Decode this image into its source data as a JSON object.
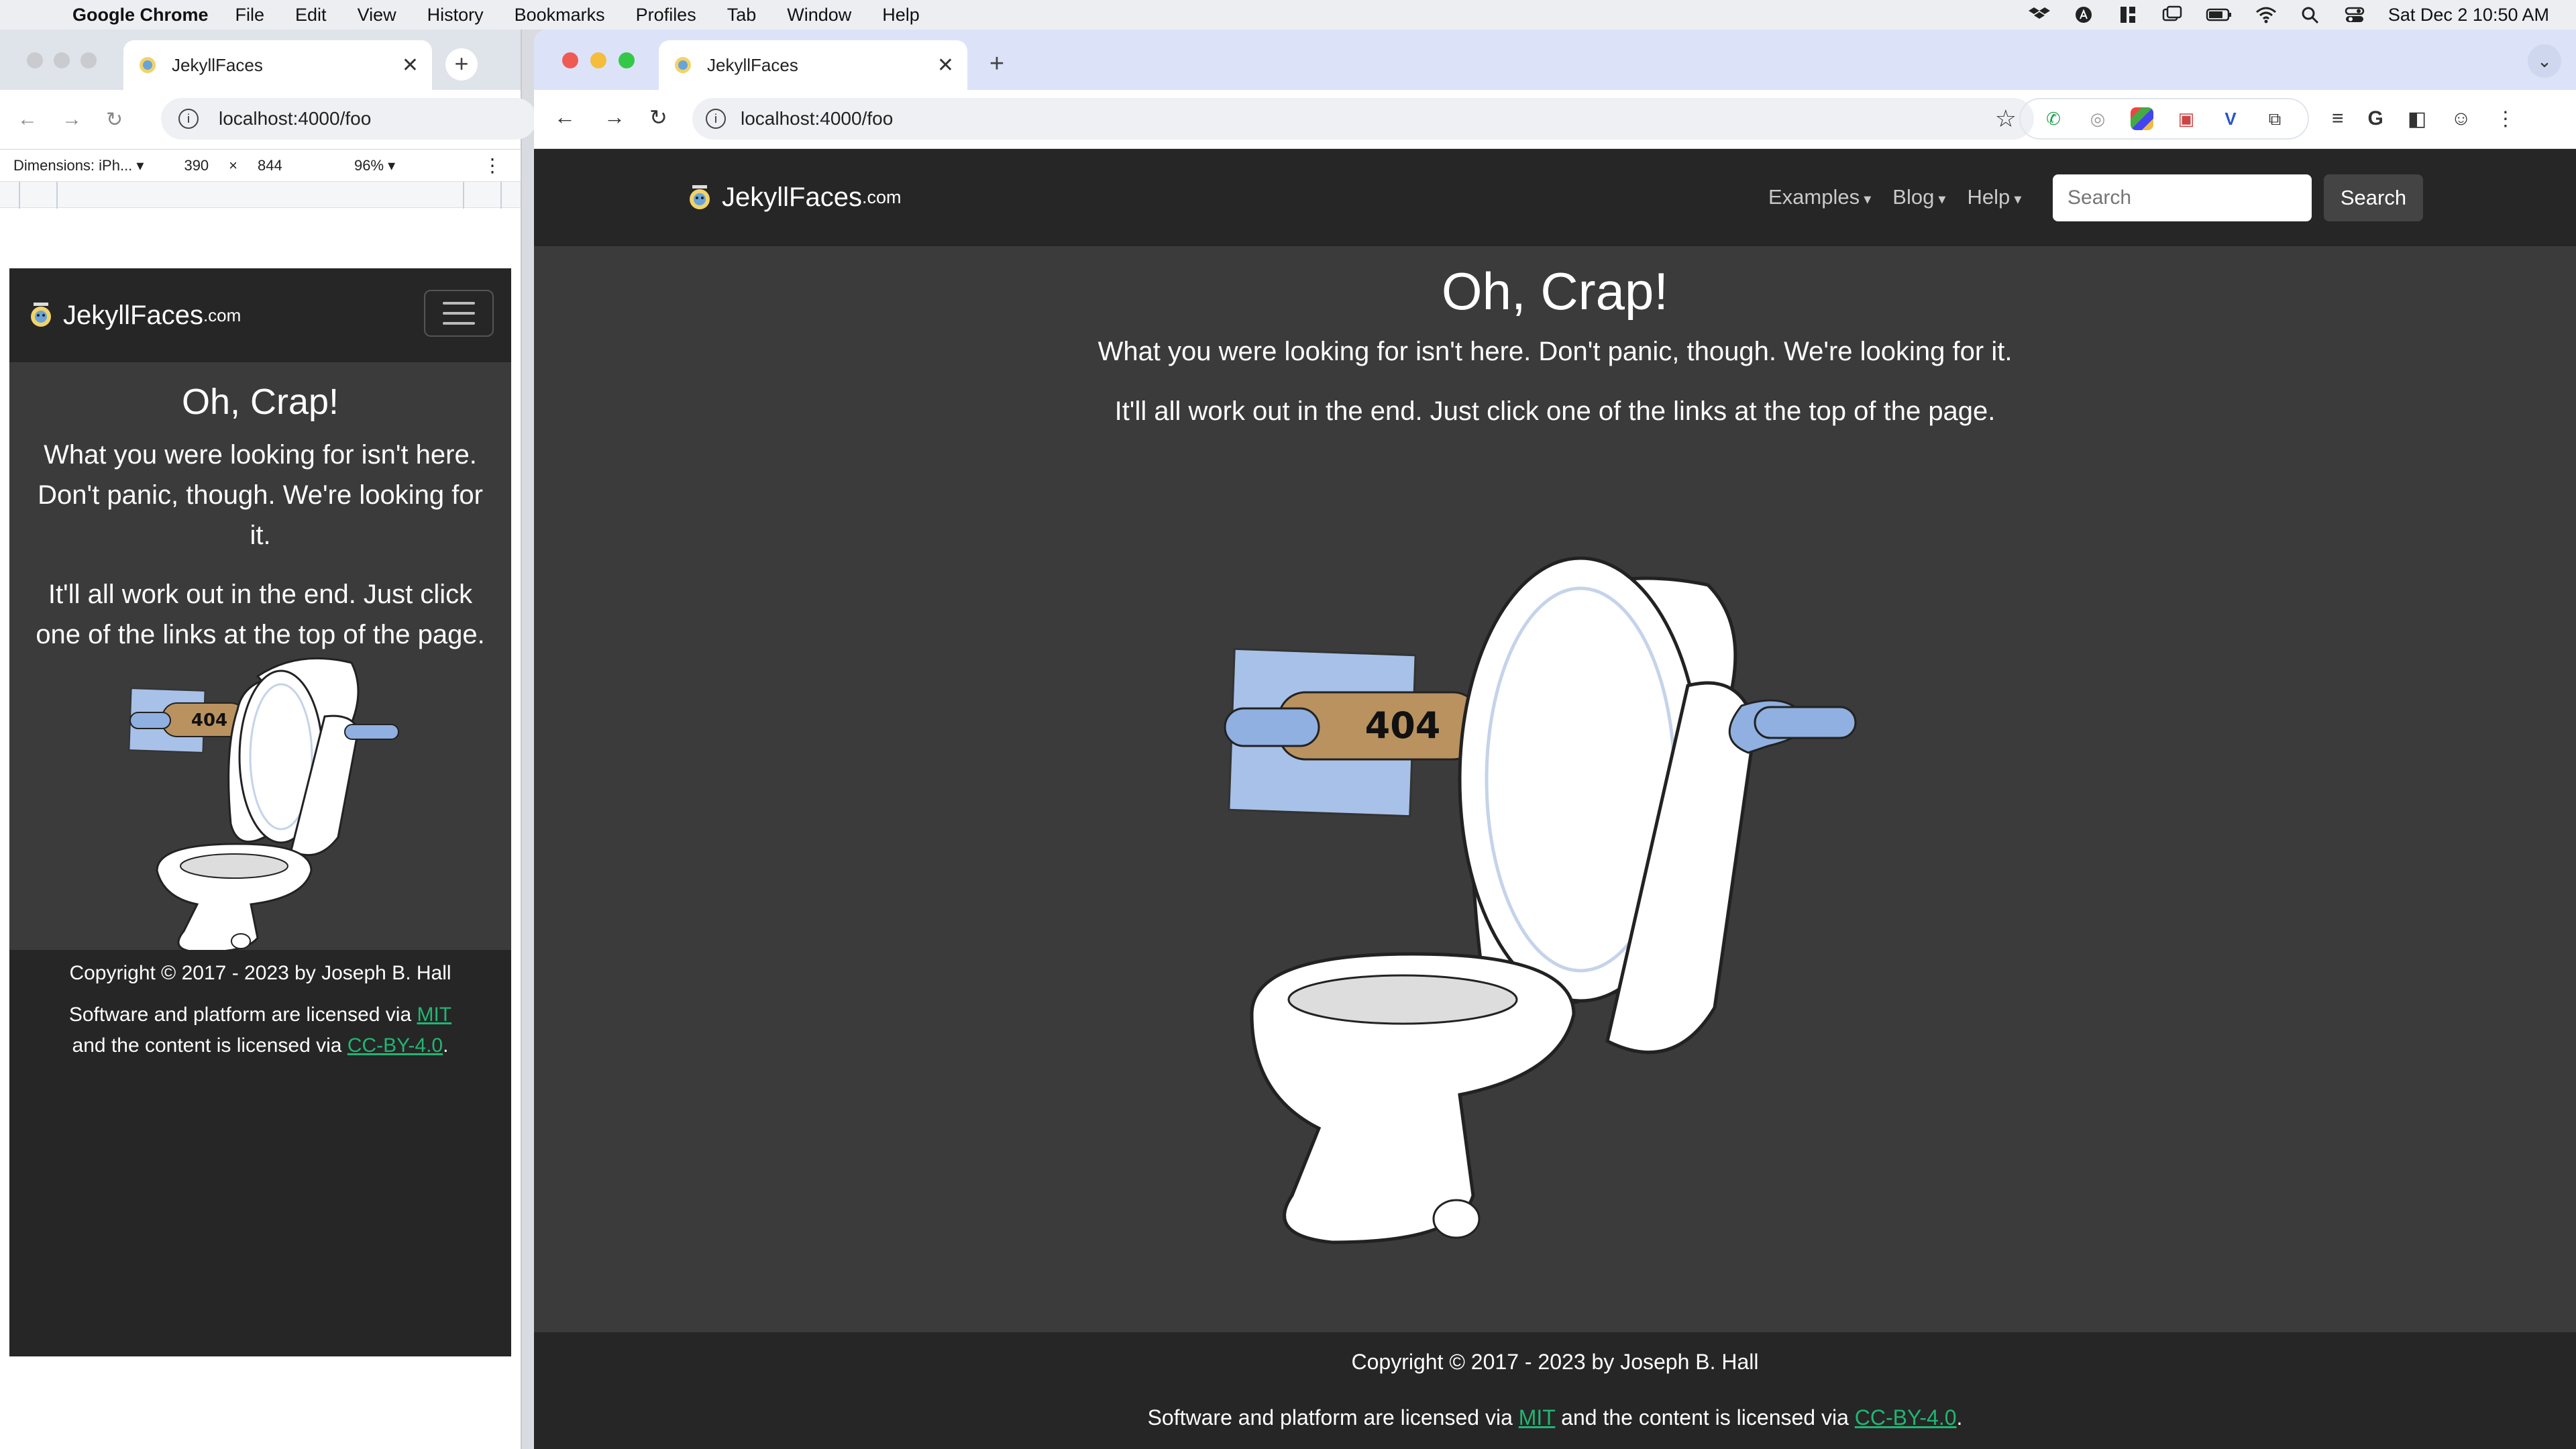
{
  "menubar": {
    "app": "Google Chrome",
    "items": [
      "File",
      "Edit",
      "View",
      "History",
      "Bookmarks",
      "Profiles",
      "Tab",
      "Window",
      "Help"
    ],
    "datetime": "Sat Dec 2  10:50 AM"
  },
  "left_window": {
    "tab_title": "JekyllFaces",
    "url": "localhost:4000/foo",
    "devtools": {
      "device_select": "Dimensions: iPh...",
      "width": "390",
      "times": "×",
      "height": "844",
      "zoom": "96%"
    }
  },
  "right_window": {
    "tab_title": "JekyllFaces",
    "url": "localhost:4000/foo"
  },
  "site": {
    "brand": "JekyllFaces",
    "brand_suffix": ".com",
    "nav": [
      "Examples",
      "Blog",
      "Help"
    ],
    "search_placeholder": "Search",
    "search_button": "Search",
    "title": "Oh, Crap!",
    "line1": "What you were looking for isn't here. Don't panic, though. We're looking for it.",
    "line2": "It'll all work out in the end. Just click one of the links at the top of the page.",
    "roll_label": "404",
    "footer": {
      "copyright": "Copyright © 2017 - 2023 by Joseph B. Hall",
      "license_prefix": "Software and platform are licensed via",
      "license_mit": "MIT",
      "license_middle": "and the content is licensed via",
      "license_cc": "CC-BY-4.0",
      "license_end": "."
    }
  },
  "colors": {
    "page_bg": "#3b3b3b",
    "navbar_bg": "#262626",
    "link": "#22b573",
    "tab_strip": "#dce3f9"
  }
}
